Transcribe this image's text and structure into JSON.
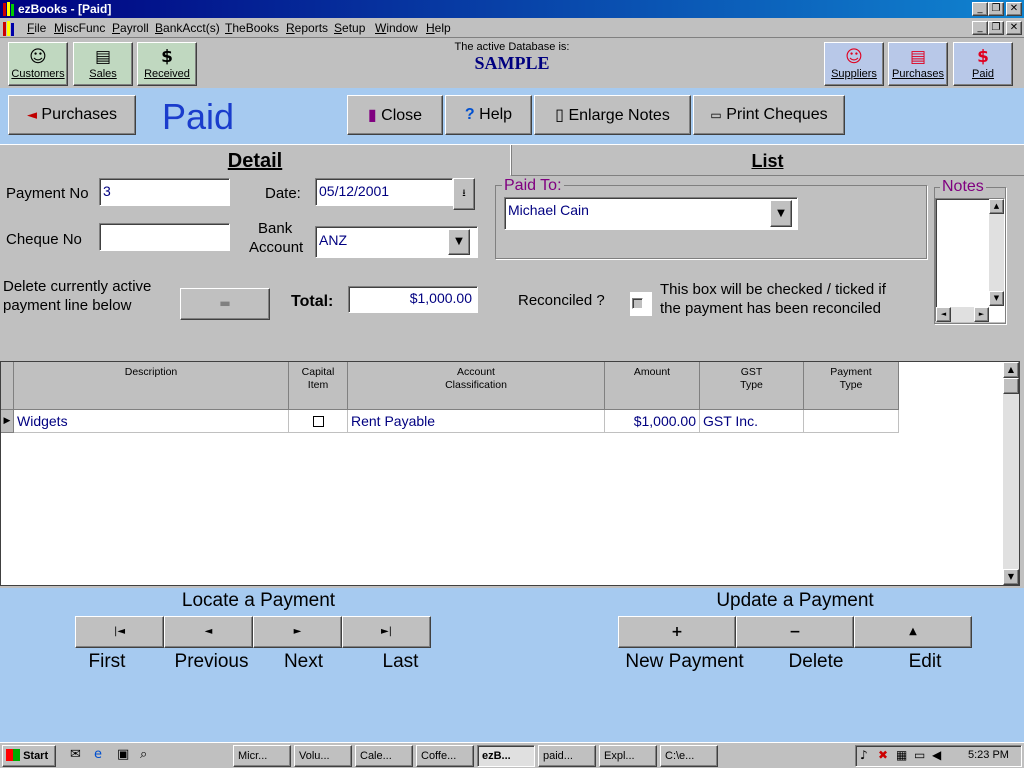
{
  "window": {
    "title": "ezBooks - [Paid]"
  },
  "menu": [
    "File",
    "MiscFunc",
    "Payroll",
    "BankAcct(s)",
    "TheBooks",
    "Reports",
    "Setup",
    "Window",
    "Help"
  ],
  "toolbar": {
    "db_caption": "The active Database is:",
    "db_name": "SAMPLE",
    "left": [
      {
        "label": "Customers",
        "icon": "smiley-icon"
      },
      {
        "label": "Sales",
        "icon": "documents-icon"
      },
      {
        "label": "Received",
        "icon": "dollar-icon"
      }
    ],
    "right": [
      {
        "label": "Suppliers",
        "icon": "smiley-icon"
      },
      {
        "label": "Purchases",
        "icon": "documents-icon"
      },
      {
        "label": "Paid",
        "icon": "dollar-icon"
      }
    ]
  },
  "header": {
    "back_label": "Purchases",
    "form_title": "Paid",
    "close_label": "Close",
    "help_label": "Help",
    "enlarge_label": "Enlarge Notes",
    "print_label": "Print Cheques"
  },
  "tabs": {
    "detail": "Detail",
    "list": "List"
  },
  "form": {
    "payment_no_label": "Payment No",
    "payment_no": "3",
    "date_label": "Date:",
    "date": "05/12/2001",
    "cheque_no_label": "Cheque No",
    "cheque_no": "",
    "bank_label_1": "Bank",
    "bank_label_2": "Account",
    "bank": "ANZ",
    "paid_to_label": "Paid To:",
    "paid_to": "Michael Cain",
    "notes_label": "Notes",
    "delete_line_1": "Delete currently active",
    "delete_line_2": "payment line below",
    "total_label": "Total:",
    "total": "$1,000.00",
    "reconciled_label": "Reconciled ?",
    "reconciled_note_1": "This box will be checked / ticked if",
    "reconciled_note_2": "the payment has been reconciled"
  },
  "grid": {
    "columns": [
      [
        "Description"
      ],
      [
        "Capital",
        "Item"
      ],
      [
        "Account",
        "Classification"
      ],
      [
        "Amount"
      ],
      [
        "GST",
        "Type"
      ],
      [
        "Payment",
        "Type"
      ]
    ],
    "rows": [
      {
        "description": "Widgets",
        "capital": false,
        "account": "Rent Payable",
        "amount": "$1,000.00",
        "gst": "GST Inc.",
        "payment_type": ""
      }
    ]
  },
  "locate": {
    "title": "Locate a Payment",
    "buttons": [
      {
        "label": "First",
        "icon": "first-record-icon",
        "glyph": "|◄"
      },
      {
        "label": "Previous",
        "icon": "previous-record-icon",
        "glyph": "◄"
      },
      {
        "label": "Next",
        "icon": "next-record-icon",
        "glyph": "►"
      },
      {
        "label": "Last",
        "icon": "last-record-icon",
        "glyph": "►|"
      }
    ]
  },
  "update": {
    "title": "Update a Payment",
    "buttons": [
      {
        "label": "New Payment",
        "icon": "plus-icon",
        "glyph": "+"
      },
      {
        "label": "Delete",
        "icon": "minus-icon",
        "glyph": "−"
      },
      {
        "label": "Edit",
        "icon": "up-arrow-icon",
        "glyph": "▲"
      }
    ]
  },
  "taskbar": {
    "start": "Start",
    "tasks": [
      "Micr...",
      "Volu...",
      "Cale...",
      "Coffe...",
      "ezB...",
      "paid...",
      "Expl...",
      "C:\\e..."
    ],
    "clock": "5:23 PM"
  },
  "colors": {
    "panel_blue": "#a6caf0",
    "title_blue": "#000080",
    "accent_title": "#1a3ccc",
    "purple_label": "#800080"
  }
}
